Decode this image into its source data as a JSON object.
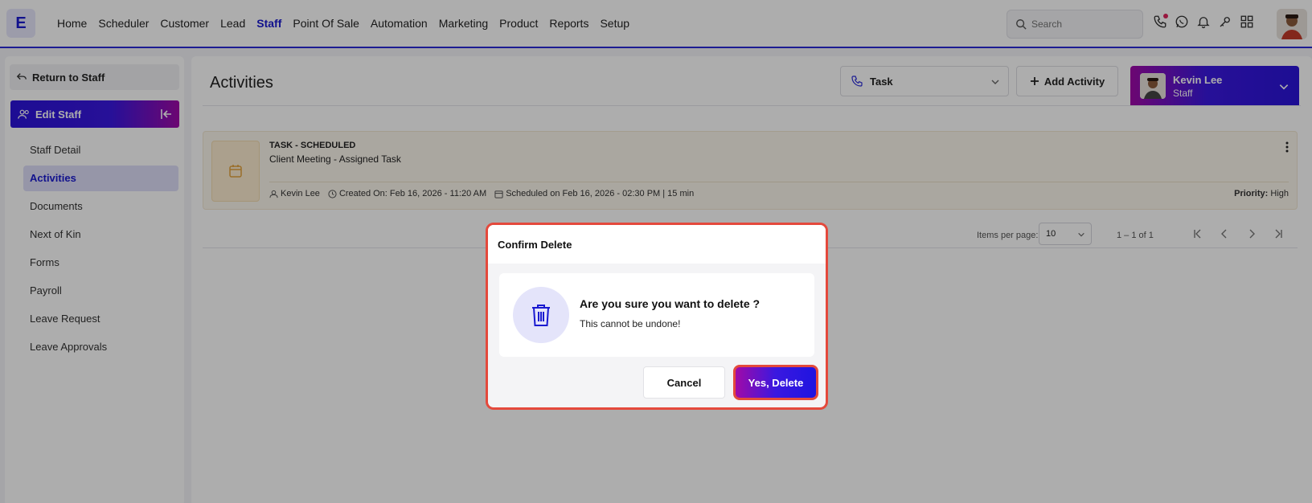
{
  "app": {
    "logo_letter": "E"
  },
  "nav": {
    "items": [
      {
        "label": "Home"
      },
      {
        "label": "Scheduler"
      },
      {
        "label": "Customer"
      },
      {
        "label": "Lead"
      },
      {
        "label": "Staff"
      },
      {
        "label": "Point Of Sale"
      },
      {
        "label": "Automation"
      },
      {
        "label": "Marketing"
      },
      {
        "label": "Product"
      },
      {
        "label": "Reports"
      },
      {
        "label": "Setup"
      }
    ],
    "active": "Staff"
  },
  "search": {
    "placeholder": "Search"
  },
  "sidebar": {
    "return_label": "Return to Staff",
    "section_label": "Edit Staff",
    "items": [
      {
        "label": "Staff Detail"
      },
      {
        "label": "Activities"
      },
      {
        "label": "Documents"
      },
      {
        "label": "Next of Kin"
      },
      {
        "label": "Forms"
      },
      {
        "label": "Payroll"
      },
      {
        "label": "Leave Request"
      },
      {
        "label": "Leave Approvals"
      }
    ],
    "active": "Activities"
  },
  "main": {
    "title": "Activities",
    "type_select": {
      "value": "Task"
    },
    "add_activity_label": "Add Activity",
    "user": {
      "name": "Kevin Lee",
      "role": "Staff"
    },
    "activity": {
      "status": "TASK - SCHEDULED",
      "title": "Client Meeting - Assigned Task",
      "owner": "Kevin Lee",
      "created": "Created On: Feb 16, 2026 - 11:20 AM",
      "scheduled": "Scheduled on Feb 16, 2026 - 02:30 PM | 15 min",
      "priority_label": "Priority:",
      "priority_value": "High"
    },
    "pager": {
      "items_per_page_label": "Items per page:",
      "items_per_page_value": "10",
      "range": "1 – 1 of 1"
    }
  },
  "modal": {
    "title": "Confirm Delete",
    "question": "Are you sure you want to delete ?",
    "subtext": "This cannot be undone!",
    "cancel_label": "Cancel",
    "confirm_label": "Yes, Delete"
  },
  "colors": {
    "accent": "#1a1ad0",
    "gradient_start": "#a00aa8",
    "gradient_end": "#2b14d9",
    "highlight_border": "#e4493c"
  }
}
